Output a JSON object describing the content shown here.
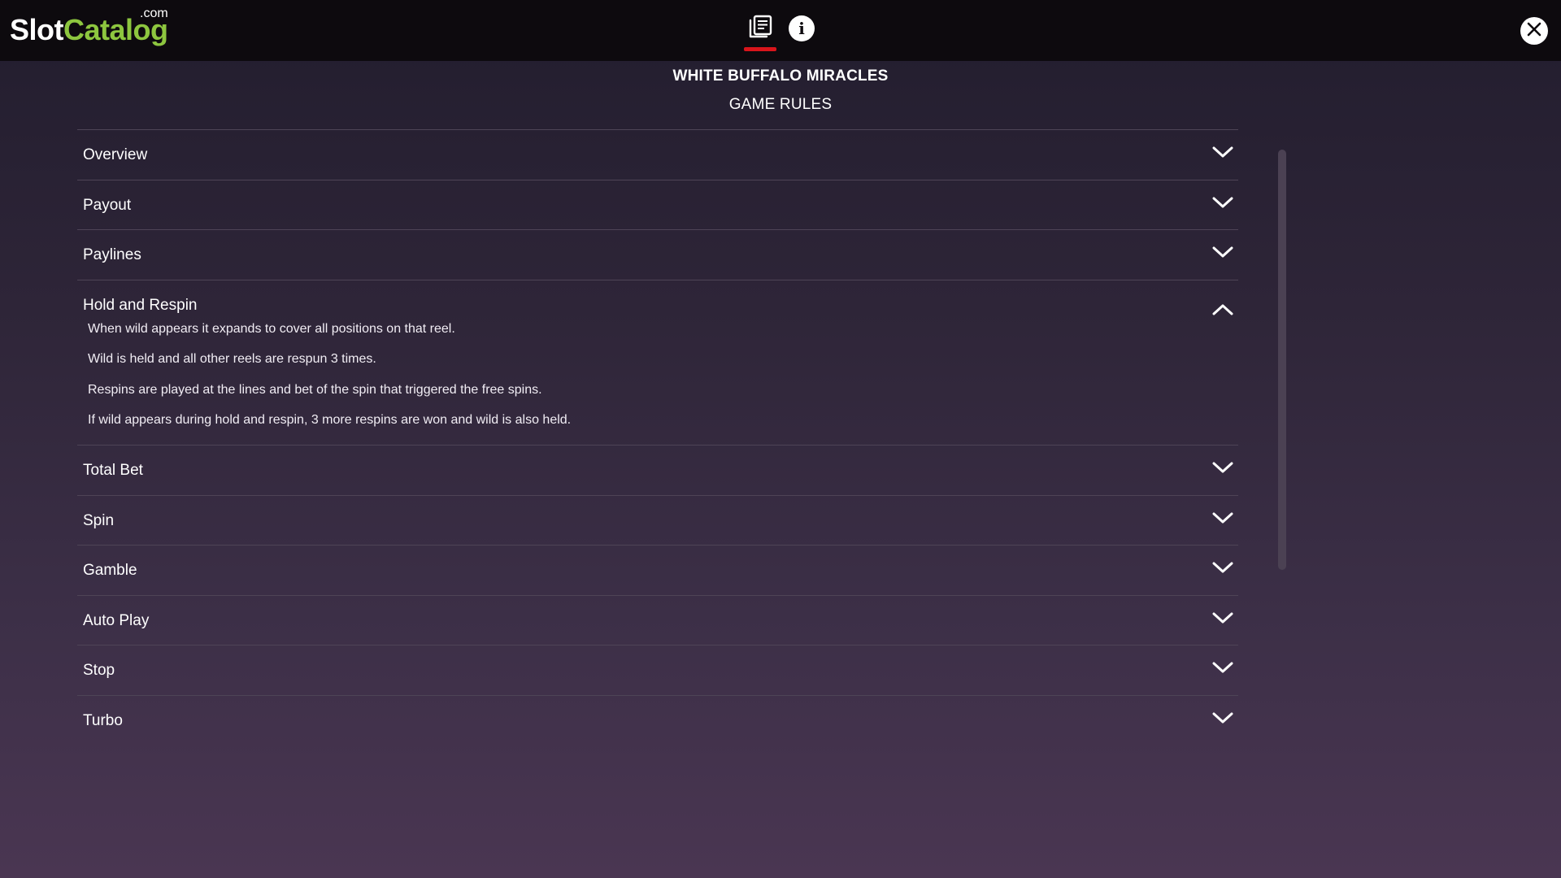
{
  "header": {
    "logo": {
      "slot": "Slot",
      "catalog": "Catalog",
      "dotcom": ".com"
    },
    "tabs": [
      {
        "name": "rules",
        "icon": "book-icon",
        "active": true
      },
      {
        "name": "info",
        "icon": "info-icon",
        "label": "i",
        "active": false
      }
    ],
    "close_icon": "close-icon"
  },
  "page": {
    "title": "WHITE BUFFALO MIRACLES",
    "subtitle": "GAME RULES"
  },
  "accordion": {
    "items": [
      {
        "label": "Overview",
        "open": false
      },
      {
        "label": "Payout",
        "open": false
      },
      {
        "label": "Paylines",
        "open": false
      },
      {
        "label": "Hold and Respin",
        "open": true,
        "body": [
          "When wild appears it expands to cover all positions on that reel.",
          "Wild is held and all other reels are respun 3 times.",
          "Respins are played at the lines and bet of the spin that triggered the free spins.",
          "If wild appears during hold and respin, 3 more respins are won and wild is also held."
        ]
      },
      {
        "label": "Total Bet",
        "open": false
      },
      {
        "label": "Spin",
        "open": false
      },
      {
        "label": "Gamble",
        "open": false
      },
      {
        "label": "Auto Play",
        "open": false
      },
      {
        "label": "Stop",
        "open": false
      },
      {
        "label": "Turbo",
        "open": false
      }
    ]
  },
  "colors": {
    "brand_green": "#8dc63f",
    "tab_indicator": "#d9151b",
    "topbar_bg": "#0d0a0e"
  }
}
